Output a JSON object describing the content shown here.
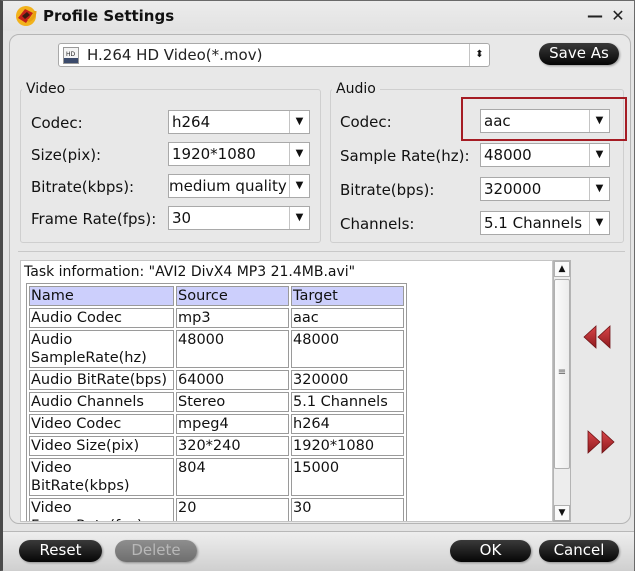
{
  "window": {
    "title": "Profile Settings",
    "minimize_glyph": "—",
    "close_glyph": "✕"
  },
  "format": {
    "selected": "H.264 HD Video(*.mov)",
    "icon": "hd-mov-file-icon",
    "save_as_label": "Save As"
  },
  "video": {
    "legend": "Video",
    "fields": [
      {
        "label": "Codec:",
        "value": "h264"
      },
      {
        "label": "Size(pix):",
        "value": "1920*1080"
      },
      {
        "label": "Bitrate(kbps):",
        "value": "medium quality"
      },
      {
        "label": "Frame Rate(fps):",
        "value": "30"
      }
    ]
  },
  "audio": {
    "legend": "Audio",
    "fields": [
      {
        "label": "Codec:",
        "value": "aac"
      },
      {
        "label": "Sample Rate(hz):",
        "value": "48000"
      },
      {
        "label": "Bitrate(bps):",
        "value": "320000"
      },
      {
        "label": "Channels:",
        "value": "5.1 Channels"
      }
    ],
    "highlight_color": "#a51c24"
  },
  "task_info": {
    "title": "Task information: \"AVI2 DivX4 MP3 21.4MB.avi\"",
    "columns": [
      "Name",
      "Source",
      "Target"
    ],
    "header_color": "#cccffc",
    "rows": [
      [
        "Audio Codec",
        "mp3",
        "aac"
      ],
      [
        "Audio SampleRate(hz)",
        "48000",
        "48000"
      ],
      [
        "Audio BitRate(bps)",
        "64000",
        "320000"
      ],
      [
        "Audio Channels",
        "Stereo",
        "5.1 Channels"
      ],
      [
        "Video Codec",
        "mpeg4",
        "h264"
      ],
      [
        "Video Size(pix)",
        "320*240",
        "1920*1080"
      ],
      [
        "Video BitRate(kbps)",
        "804",
        "15000"
      ],
      [
        "Video FrameRate(fps)",
        "20",
        "30"
      ]
    ]
  },
  "scrollbar": {
    "up_glyph": "▲",
    "down_glyph": "▼",
    "grip_glyph": "≡"
  },
  "nav": {
    "prev_icon": "rewind-icon",
    "next_icon": "fast-forward-icon",
    "arrow_color": "#b3262b"
  },
  "buttons": {
    "reset": "Reset",
    "delete": "Delete",
    "ok": "OK",
    "cancel": "Cancel"
  },
  "glyphs": {
    "dropdown": "▼",
    "updown": "⬍"
  }
}
